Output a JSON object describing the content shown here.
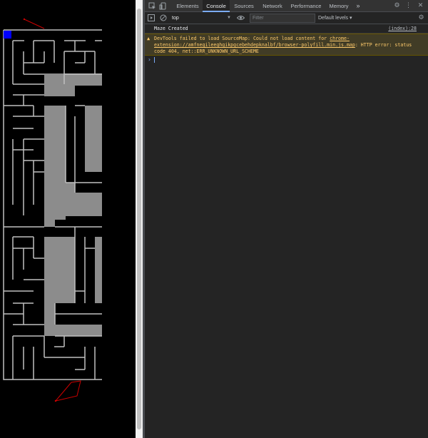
{
  "devtools": {
    "tabs": [
      {
        "label": "Elements",
        "active": false
      },
      {
        "label": "Console",
        "active": true
      },
      {
        "label": "Sources",
        "active": false
      },
      {
        "label": "Network",
        "active": false
      },
      {
        "label": "Performance",
        "active": false
      },
      {
        "label": "Memory",
        "active": false
      }
    ],
    "more_tabs": "»",
    "toolbar": {
      "context": "top",
      "filter_placeholder": "Filter",
      "levels": "Default levels ▾"
    },
    "console": {
      "log_text": "Maze Created",
      "log_source": "(index):28",
      "warning": {
        "prefix": "DevTools failed to load SourceMap: Could not load content for ",
        "url": "chrome-extension://amfnegileeghgikpgcebehdepknalbf/browser-polyfill.min.js.map",
        "suffix": ": HTTP error: status code 404, net::ERR_UNKNOWN_URL_SCHEME"
      },
      "prompt": "›"
    }
  },
  "colors": {
    "player": "#0000ff",
    "maze_wall": "#c0c0c0",
    "visited_block": "#8c8c8c",
    "path_line": "#cc0000",
    "accent": "#7cacf8"
  }
}
